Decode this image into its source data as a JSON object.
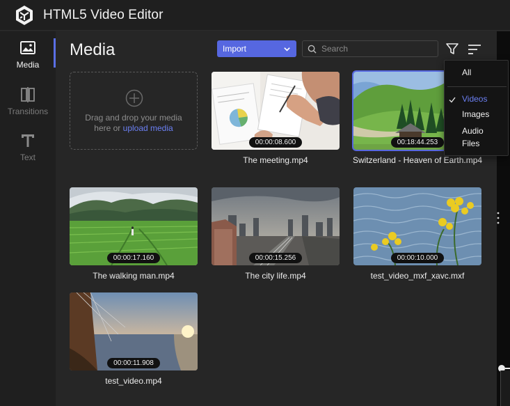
{
  "header": {
    "title": "HTML5 Video Editor",
    "logo_icon": "hexagon-logo-icon"
  },
  "sidebar": {
    "items": [
      {
        "id": "media",
        "label": "Media",
        "icon": "image-icon",
        "active": true
      },
      {
        "id": "transitions",
        "label": "Transitions",
        "icon": "transitions-icon",
        "active": false
      },
      {
        "id": "text",
        "label": "Text",
        "icon": "text-t-icon",
        "active": false
      }
    ]
  },
  "main": {
    "title": "Media",
    "import_label": "Import",
    "search": {
      "placeholder": "Search",
      "value": ""
    },
    "dropzone": {
      "text_line1": "Drag and drop your media",
      "text_prefix": "here or ",
      "link": "upload media"
    }
  },
  "media": [
    {
      "name": "The meeting.mp4",
      "duration": "00:00:08.600",
      "selected": false
    },
    {
      "name": "Switzerland - Heaven of Earth.mp4",
      "duration": "00:18:44.253",
      "selected": true
    },
    {
      "name": "The walking man.mp4",
      "duration": "00:00:17.160",
      "selected": false
    },
    {
      "name": "The city life.mp4",
      "duration": "00:00:15.256",
      "selected": false
    },
    {
      "name": "test_video_mxf_xavc.mxf",
      "duration": "00:00:10.000",
      "selected": false
    },
    {
      "name": "test_video.mp4",
      "duration": "00:00:11.908",
      "selected": false
    }
  ],
  "filter_menu": {
    "items": [
      {
        "label": "All",
        "checked": false
      },
      {
        "label": "Videos",
        "checked": true
      },
      {
        "label": "Images",
        "checked": false
      },
      {
        "label": "Audio Files",
        "checked": false
      }
    ]
  },
  "colors": {
    "accent": "#5667e0",
    "link": "#6b7ff2",
    "background": "#262626",
    "sidebar": "#1f1f1f"
  }
}
